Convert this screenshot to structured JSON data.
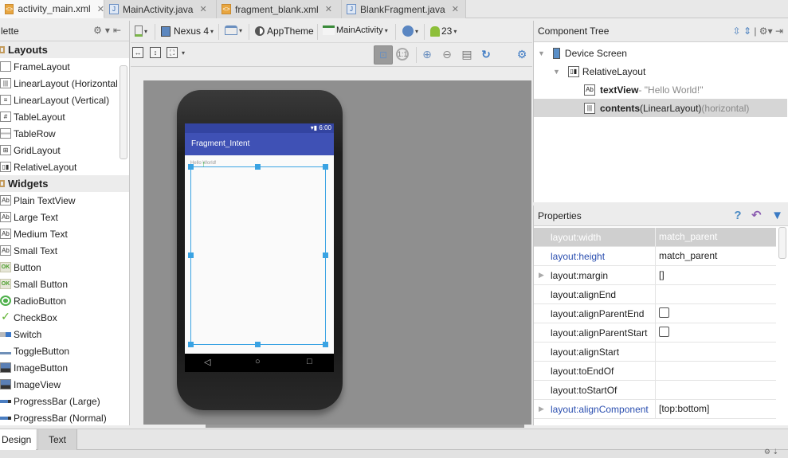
{
  "editor_tabs": [
    {
      "label": "activity_main.xml",
      "type": "xml",
      "active": true
    },
    {
      "label": "MainActivity.java",
      "type": "java",
      "active": false
    },
    {
      "label": "fragment_blank.xml",
      "type": "xml",
      "active": false
    },
    {
      "label": "BlankFragment.java",
      "type": "java",
      "active": false
    }
  ],
  "palette": {
    "title": "lette",
    "categories": [
      {
        "label": "Layouts",
        "items": [
          "FrameLayout",
          "LinearLayout (Horizontal",
          "LinearLayout (Vertical)",
          "TableLayout",
          "TableRow",
          "GridLayout",
          "RelativeLayout"
        ]
      },
      {
        "label": "Widgets",
        "items": [
          "Plain TextView",
          "Large Text",
          "Medium Text",
          "Small Text",
          "Button",
          "Small Button",
          "RadioButton",
          "CheckBox",
          "Switch",
          "ToggleButton",
          "ImageButton",
          "ImageView",
          "ProgressBar (Large)",
          "ProgressBar (Normal)"
        ]
      }
    ]
  },
  "toolbar": {
    "device": "Nexus 4",
    "theme": "AppTheme",
    "activity": "MainActivity",
    "api_level": "23",
    "zoom_one_to_one": "1:1"
  },
  "preview": {
    "status_time": "6:00",
    "app_title": "Fragment_Intent",
    "hello_text": "Hello World!"
  },
  "component_tree": {
    "title": "Component Tree",
    "nodes": [
      {
        "name": "Device Screen",
        "detail": ""
      },
      {
        "name": "RelativeLayout",
        "detail": ""
      },
      {
        "name": "textView",
        "detail": " - \"Hello World!\""
      },
      {
        "name": "contents",
        "detail": " (LinearLayout)",
        "extra": " (horizontal)"
      }
    ]
  },
  "properties": {
    "title": "Properties",
    "rows": [
      {
        "name": "layout:width",
        "value": "match_parent"
      },
      {
        "name": "layout:height",
        "value": "match_parent"
      },
      {
        "name": "layout:margin",
        "value": "[]"
      },
      {
        "name": "layout:alignEnd",
        "value": ""
      },
      {
        "name": "layout:alignParentEnd",
        "value": ""
      },
      {
        "name": "layout:alignParentStart",
        "value": ""
      },
      {
        "name": "layout:alignStart",
        "value": ""
      },
      {
        "name": "layout:toEndOf",
        "value": ""
      },
      {
        "name": "layout:toStartOf",
        "value": ""
      },
      {
        "name": "layout:alignComponent",
        "value": "[top:bottom]"
      }
    ]
  },
  "bottom_tabs": {
    "design": "Design",
    "text": "Text"
  }
}
